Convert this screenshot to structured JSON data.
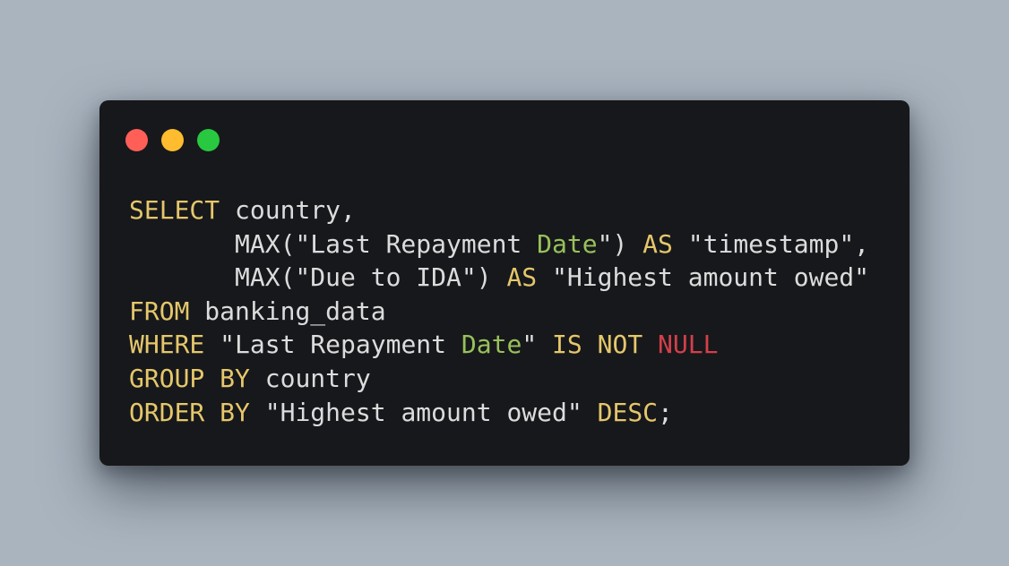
{
  "window": {
    "controls": {
      "close_color": "#ff5f57",
      "minimize_color": "#febc2e",
      "maximize_color": "#28c840"
    }
  },
  "colors": {
    "background": "#a9b4bf",
    "editor_background": "#17181b",
    "keyword": "#e5c76b",
    "type": "#98c15b",
    "null": "#d2404a",
    "text": "#dcdcdc"
  },
  "code": {
    "lines": [
      [
        {
          "text": "SELECT",
          "kind": "keyword"
        },
        {
          "text": " country,",
          "kind": "text"
        }
      ],
      [
        {
          "text": "       MAX(\"Last Repayment ",
          "kind": "text"
        },
        {
          "text": "Date",
          "kind": "type"
        },
        {
          "text": "\") ",
          "kind": "text"
        },
        {
          "text": "AS",
          "kind": "keyword"
        },
        {
          "text": " \"timestamp\",",
          "kind": "text"
        }
      ],
      [
        {
          "text": "       MAX(\"Due to IDA\") ",
          "kind": "text"
        },
        {
          "text": "AS",
          "kind": "keyword"
        },
        {
          "text": " \"Highest amount owed\"",
          "kind": "text"
        }
      ],
      [
        {
          "text": "FROM",
          "kind": "keyword"
        },
        {
          "text": " banking_data",
          "kind": "text"
        }
      ],
      [
        {
          "text": "WHERE",
          "kind": "keyword"
        },
        {
          "text": " \"Last Repayment ",
          "kind": "text"
        },
        {
          "text": "Date",
          "kind": "type"
        },
        {
          "text": "\" ",
          "kind": "text"
        },
        {
          "text": "IS",
          "kind": "keyword"
        },
        {
          "text": " ",
          "kind": "text"
        },
        {
          "text": "NOT",
          "kind": "keyword"
        },
        {
          "text": " ",
          "kind": "text"
        },
        {
          "text": "NULL",
          "kind": "null"
        }
      ],
      [
        {
          "text": "GROUP",
          "kind": "keyword"
        },
        {
          "text": " ",
          "kind": "text"
        },
        {
          "text": "BY",
          "kind": "keyword"
        },
        {
          "text": " country",
          "kind": "text"
        }
      ],
      [
        {
          "text": "ORDER",
          "kind": "keyword"
        },
        {
          "text": " ",
          "kind": "text"
        },
        {
          "text": "BY",
          "kind": "keyword"
        },
        {
          "text": " \"Highest amount owed\" ",
          "kind": "text"
        },
        {
          "text": "DESC",
          "kind": "keyword"
        },
        {
          "text": ";",
          "kind": "text"
        }
      ]
    ]
  }
}
